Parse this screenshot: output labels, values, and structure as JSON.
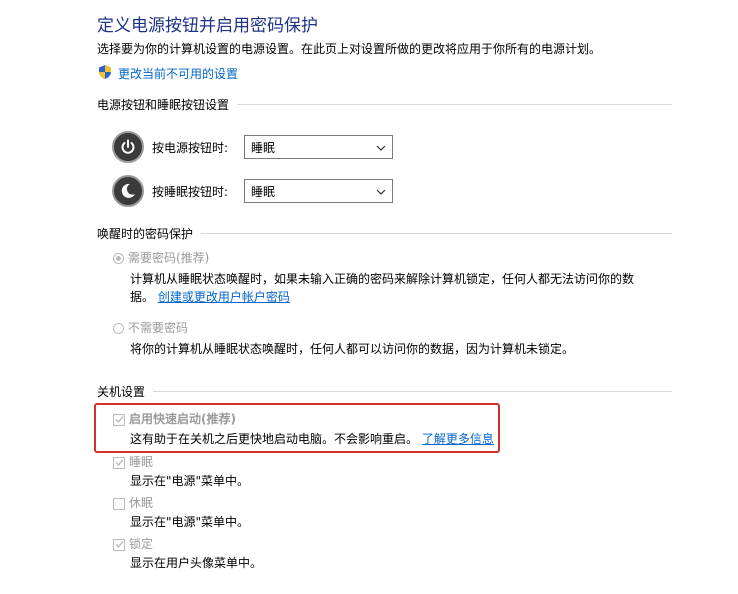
{
  "page": {
    "title": "定义电源按钮并启用密码保护",
    "description": "选择要为你的计算机设置的电源设置。在此页上对设置所做的更改将应用于你所有的电源计划。",
    "admin_link": "更改当前不可用的设置"
  },
  "power_buttons": {
    "heading": "电源按钮和睡眠按钮设置",
    "rows": [
      {
        "label": "按电源按钮时:",
        "value": "睡眠",
        "icon": "power-icon"
      },
      {
        "label": "按睡眠按钮时:",
        "value": "睡眠",
        "icon": "sleep-icon"
      }
    ]
  },
  "wake_password": {
    "heading": "唤醒时的密码保护",
    "require": {
      "label": "需要密码(推荐)",
      "selected": true,
      "desc_line1": "计算机从睡眠状态唤醒时，如果未输入正确的密码来解除计算机锁定，任何人都无法访问你的数",
      "desc_line2_prefix": "据。",
      "link": "创建或更改用户帐户密码"
    },
    "no_require": {
      "label": "不需要密码",
      "selected": false,
      "desc": "将你的计算机从睡眠状态唤醒时，任何人都可以访问你的数据，因为计算机未锁定。"
    }
  },
  "shutdown": {
    "heading": "关机设置",
    "fast_startup": {
      "label": "启用快速启动(推荐)",
      "checked": true,
      "desc": "这有助于在关机之后更快地启动电脑。不会影响重启。",
      "link": "了解更多信息"
    },
    "sleep": {
      "label": "睡眠",
      "checked": true,
      "desc": "显示在\"电源\"菜单中。"
    },
    "hibernate": {
      "label": "休眠",
      "checked": false,
      "desc": "显示在\"电源\"菜单中。"
    },
    "lock": {
      "label": "锁定",
      "checked": true,
      "desc": "显示在用户头像菜单中。"
    }
  },
  "colors": {
    "title": "#1e3287",
    "link": "#0066cc",
    "highlight": "#d32f2f",
    "disabled": "#9a9a9a"
  }
}
